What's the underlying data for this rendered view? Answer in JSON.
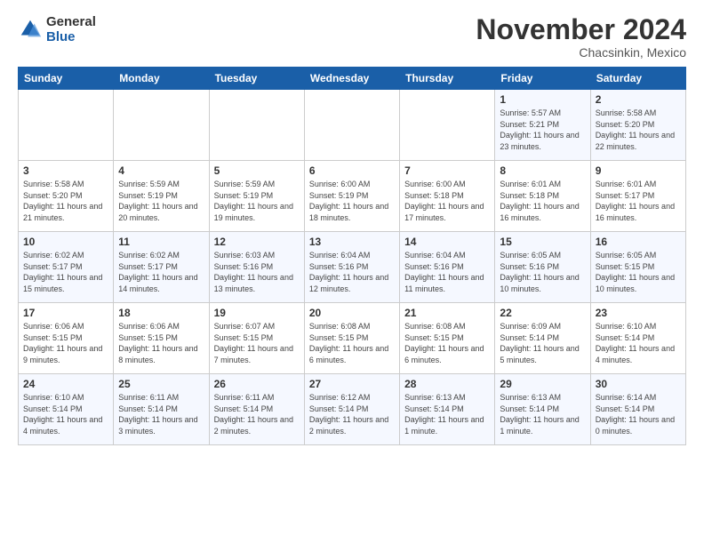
{
  "header": {
    "logo_line1": "General",
    "logo_line2": "Blue",
    "month": "November 2024",
    "location": "Chacsinkin, Mexico"
  },
  "days_of_week": [
    "Sunday",
    "Monday",
    "Tuesday",
    "Wednesday",
    "Thursday",
    "Friday",
    "Saturday"
  ],
  "weeks": [
    [
      {
        "day": "",
        "info": ""
      },
      {
        "day": "",
        "info": ""
      },
      {
        "day": "",
        "info": ""
      },
      {
        "day": "",
        "info": ""
      },
      {
        "day": "",
        "info": ""
      },
      {
        "day": "1",
        "info": "Sunrise: 5:57 AM\nSunset: 5:21 PM\nDaylight: 11 hours and 23 minutes."
      },
      {
        "day": "2",
        "info": "Sunrise: 5:58 AM\nSunset: 5:20 PM\nDaylight: 11 hours and 22 minutes."
      }
    ],
    [
      {
        "day": "3",
        "info": "Sunrise: 5:58 AM\nSunset: 5:20 PM\nDaylight: 11 hours and 21 minutes."
      },
      {
        "day": "4",
        "info": "Sunrise: 5:59 AM\nSunset: 5:19 PM\nDaylight: 11 hours and 20 minutes."
      },
      {
        "day": "5",
        "info": "Sunrise: 5:59 AM\nSunset: 5:19 PM\nDaylight: 11 hours and 19 minutes."
      },
      {
        "day": "6",
        "info": "Sunrise: 6:00 AM\nSunset: 5:19 PM\nDaylight: 11 hours and 18 minutes."
      },
      {
        "day": "7",
        "info": "Sunrise: 6:00 AM\nSunset: 5:18 PM\nDaylight: 11 hours and 17 minutes."
      },
      {
        "day": "8",
        "info": "Sunrise: 6:01 AM\nSunset: 5:18 PM\nDaylight: 11 hours and 16 minutes."
      },
      {
        "day": "9",
        "info": "Sunrise: 6:01 AM\nSunset: 5:17 PM\nDaylight: 11 hours and 16 minutes."
      }
    ],
    [
      {
        "day": "10",
        "info": "Sunrise: 6:02 AM\nSunset: 5:17 PM\nDaylight: 11 hours and 15 minutes."
      },
      {
        "day": "11",
        "info": "Sunrise: 6:02 AM\nSunset: 5:17 PM\nDaylight: 11 hours and 14 minutes."
      },
      {
        "day": "12",
        "info": "Sunrise: 6:03 AM\nSunset: 5:16 PM\nDaylight: 11 hours and 13 minutes."
      },
      {
        "day": "13",
        "info": "Sunrise: 6:04 AM\nSunset: 5:16 PM\nDaylight: 11 hours and 12 minutes."
      },
      {
        "day": "14",
        "info": "Sunrise: 6:04 AM\nSunset: 5:16 PM\nDaylight: 11 hours and 11 minutes."
      },
      {
        "day": "15",
        "info": "Sunrise: 6:05 AM\nSunset: 5:16 PM\nDaylight: 11 hours and 10 minutes."
      },
      {
        "day": "16",
        "info": "Sunrise: 6:05 AM\nSunset: 5:15 PM\nDaylight: 11 hours and 10 minutes."
      }
    ],
    [
      {
        "day": "17",
        "info": "Sunrise: 6:06 AM\nSunset: 5:15 PM\nDaylight: 11 hours and 9 minutes."
      },
      {
        "day": "18",
        "info": "Sunrise: 6:06 AM\nSunset: 5:15 PM\nDaylight: 11 hours and 8 minutes."
      },
      {
        "day": "19",
        "info": "Sunrise: 6:07 AM\nSunset: 5:15 PM\nDaylight: 11 hours and 7 minutes."
      },
      {
        "day": "20",
        "info": "Sunrise: 6:08 AM\nSunset: 5:15 PM\nDaylight: 11 hours and 6 minutes."
      },
      {
        "day": "21",
        "info": "Sunrise: 6:08 AM\nSunset: 5:15 PM\nDaylight: 11 hours and 6 minutes."
      },
      {
        "day": "22",
        "info": "Sunrise: 6:09 AM\nSunset: 5:14 PM\nDaylight: 11 hours and 5 minutes."
      },
      {
        "day": "23",
        "info": "Sunrise: 6:10 AM\nSunset: 5:14 PM\nDaylight: 11 hours and 4 minutes."
      }
    ],
    [
      {
        "day": "24",
        "info": "Sunrise: 6:10 AM\nSunset: 5:14 PM\nDaylight: 11 hours and 4 minutes."
      },
      {
        "day": "25",
        "info": "Sunrise: 6:11 AM\nSunset: 5:14 PM\nDaylight: 11 hours and 3 minutes."
      },
      {
        "day": "26",
        "info": "Sunrise: 6:11 AM\nSunset: 5:14 PM\nDaylight: 11 hours and 2 minutes."
      },
      {
        "day": "27",
        "info": "Sunrise: 6:12 AM\nSunset: 5:14 PM\nDaylight: 11 hours and 2 minutes."
      },
      {
        "day": "28",
        "info": "Sunrise: 6:13 AM\nSunset: 5:14 PM\nDaylight: 11 hours and 1 minute."
      },
      {
        "day": "29",
        "info": "Sunrise: 6:13 AM\nSunset: 5:14 PM\nDaylight: 11 hours and 1 minute."
      },
      {
        "day": "30",
        "info": "Sunrise: 6:14 AM\nSunset: 5:14 PM\nDaylight: 11 hours and 0 minutes."
      }
    ]
  ]
}
